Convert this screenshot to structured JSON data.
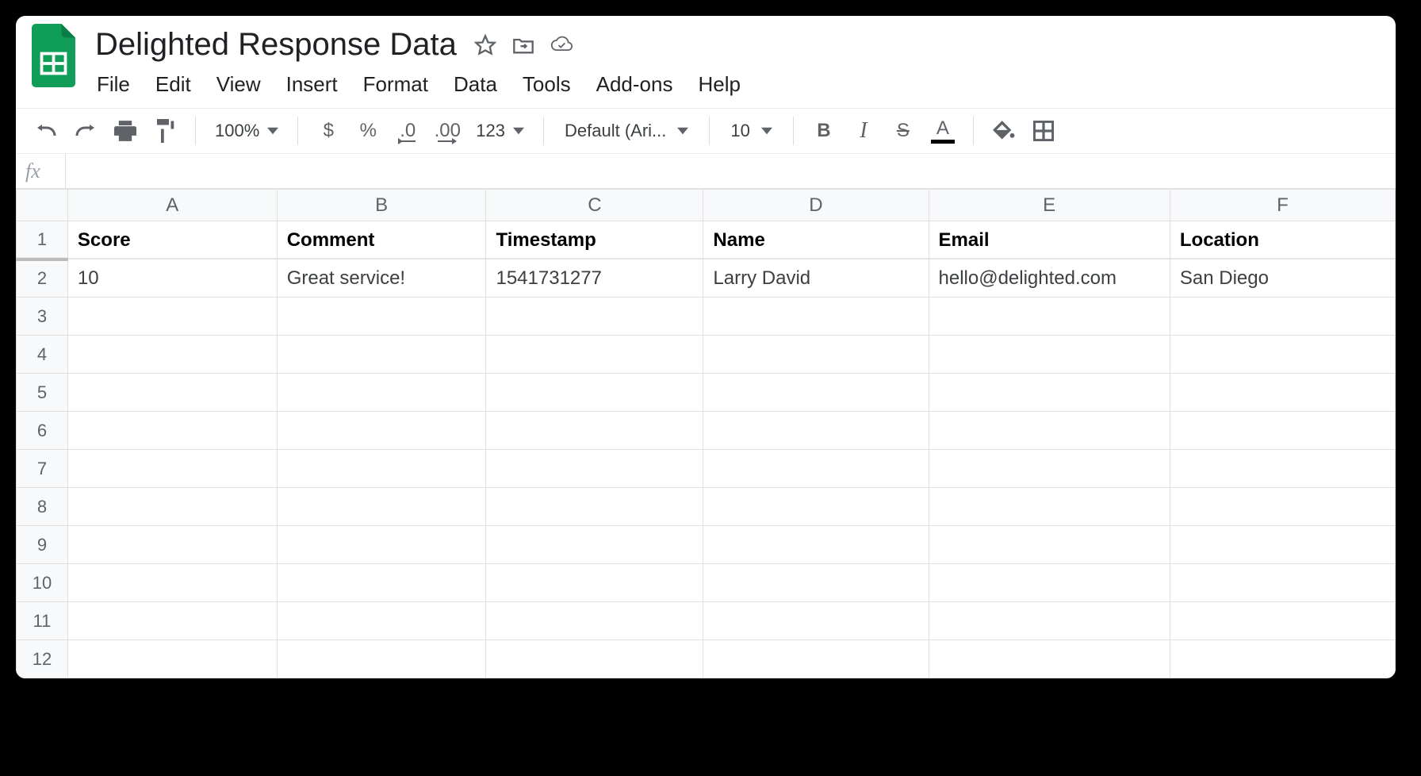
{
  "doc": {
    "title": "Delighted Response Data"
  },
  "menu": {
    "file": "File",
    "edit": "Edit",
    "view": "View",
    "insert": "Insert",
    "format": "Format",
    "data": "Data",
    "tools": "Tools",
    "addons": "Add-ons",
    "help": "Help"
  },
  "toolbar": {
    "zoom": "100%",
    "currency": "$",
    "percent": "%",
    "dec_decrease": ".0",
    "dec_increase": ".00",
    "num_format": "123",
    "font": "Default (Ari...",
    "font_size": "10",
    "bold": "B",
    "italic": "I",
    "strike": "S",
    "text_color": "A"
  },
  "formula": {
    "fx": "fx",
    "value": ""
  },
  "columns": [
    "A",
    "B",
    "C",
    "D",
    "E",
    "F"
  ],
  "row_numbers": [
    "1",
    "2",
    "3",
    "4",
    "5",
    "6",
    "7",
    "8",
    "9",
    "10",
    "11",
    "12"
  ],
  "headers": {
    "A": "Score",
    "B": "Comment",
    "C": "Timestamp",
    "D": "Name",
    "E": "Email",
    "F": "Location"
  },
  "rows": [
    {
      "A": "10",
      "B": "Great service!",
      "C": "1541731277",
      "D": "Larry David",
      "E": "hello@delighted.com",
      "F": "San Diego"
    }
  ]
}
